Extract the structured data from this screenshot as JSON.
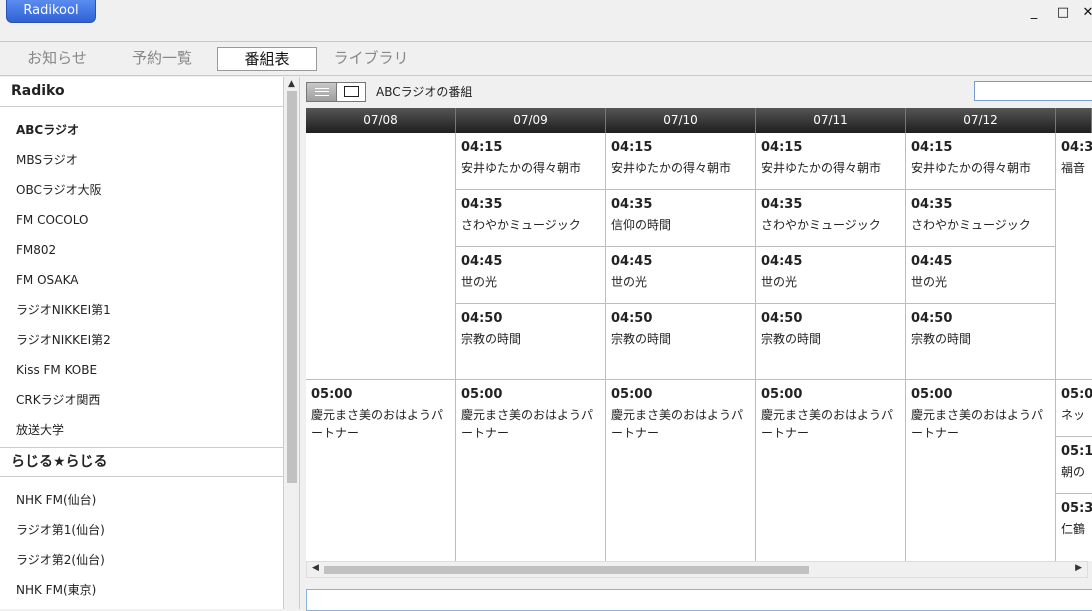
{
  "window": {
    "app_name": "Radikool",
    "minimize": "_",
    "maximize": "□",
    "close": "✕"
  },
  "tabs": [
    {
      "label": "お知らせ"
    },
    {
      "label": "予約一覧"
    },
    {
      "label": "番組表"
    },
    {
      "label": "ライブラリ"
    }
  ],
  "sidebar": {
    "groups": [
      {
        "name": "Radiko",
        "stations": [
          "ABCラジオ",
          "MBSラジオ",
          "OBCラジオ大阪",
          "FM COCOLO",
          "FM802",
          "FM OSAKA",
          "ラジオNIKKEI第1",
          "ラジオNIKKEI第2",
          "Kiss FM KOBE",
          "CRKラジオ関西",
          "放送大学"
        ]
      },
      {
        "name": "らじる★らじる",
        "stations": [
          "NHK FM(仙台)",
          "ラジオ第1(仙台)",
          "ラジオ第2(仙台)",
          "NHK FM(東京)"
        ]
      }
    ]
  },
  "schedule": {
    "title": "ABCラジオの番組",
    "days": [
      "07/08",
      "07/09",
      "07/10",
      "07/11",
      "07/12",
      ""
    ],
    "programs": {
      "col0": [
        {
          "time": "05:00",
          "title": "慶元まさ美のおはようパートナー"
        }
      ],
      "col1": [
        {
          "time": "04:15",
          "title": "安井ゆたかの得々朝市"
        },
        {
          "time": "04:35",
          "title": "さわやかミュージック"
        },
        {
          "time": "04:45",
          "title": "世の光"
        },
        {
          "time": "04:50",
          "title": "宗教の時間"
        },
        {
          "time": "05:00",
          "title": "慶元まさ美のおはようパートナー"
        }
      ],
      "col2": [
        {
          "time": "04:15",
          "title": "安井ゆたかの得々朝市"
        },
        {
          "time": "04:35",
          "title": "信仰の時間"
        },
        {
          "time": "04:45",
          "title": "世の光"
        },
        {
          "time": "04:50",
          "title": "宗教の時間"
        },
        {
          "time": "05:00",
          "title": "慶元まさ美のおはようパートナー"
        }
      ],
      "col3": [
        {
          "time": "04:15",
          "title": "安井ゆたかの得々朝市"
        },
        {
          "time": "04:35",
          "title": "さわやかミュージック"
        },
        {
          "time": "04:45",
          "title": "世の光"
        },
        {
          "time": "04:50",
          "title": "宗教の時間"
        },
        {
          "time": "05:00",
          "title": "慶元まさ美のおはようパートナー"
        }
      ],
      "col4": [
        {
          "time": "04:15",
          "title": "安井ゆたかの得々朝市"
        },
        {
          "time": "04:35",
          "title": "さわやかミュージック"
        },
        {
          "time": "04:45",
          "title": "世の光"
        },
        {
          "time": "04:50",
          "title": "宗教の時間"
        },
        {
          "time": "05:00",
          "title": "慶元まさ美のおはようパートナー"
        }
      ],
      "col5": [
        {
          "time": "04:3",
          "title": "福音"
        },
        {
          "time": "05:0",
          "title": "ネッ"
        },
        {
          "time": "05:1",
          "title": "朝の"
        },
        {
          "time": "05:3",
          "title": "仁鶴"
        }
      ]
    }
  },
  "colors": {
    "accent": "#2f62d6",
    "header_bg": "#1e1e1e",
    "grid_line": "#bdbdbd"
  }
}
